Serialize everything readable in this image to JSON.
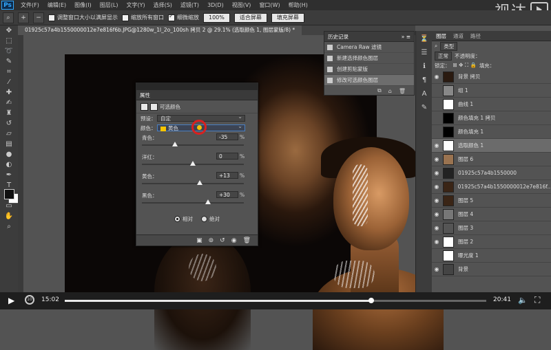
{
  "menubar": {
    "logo": "Ps",
    "items": [
      "文件(F)",
      "编辑(E)",
      "图像(I)",
      "图层(L)",
      "文字(Y)",
      "选择(S)",
      "滤镜(T)",
      "3D(D)",
      "视图(V)",
      "窗口(W)",
      "帮助(H)"
    ]
  },
  "watermark": {
    "text": "视达"
  },
  "optionsbar": {
    "resize_windows_label": "调整窗口大小以满屏显示",
    "zoom_all_label": "缩放所有窗口",
    "scrubby_zoom_label": "细微缩放",
    "zoom_value": "100%",
    "fit_screen_label": "适合屏幕",
    "fill_screen_label": "填充屏幕"
  },
  "document": {
    "tab_title": "01925c57a4b1550000012e7e816f6b.JPG@1280w_1l_2o_100sh 拷贝 2 @ 29.1% (选取颜色 1, 图层蒙版/8) *"
  },
  "history": {
    "title": "历史记录",
    "items": [
      "Camera Raw 滤镜",
      "新建选择颜色图层",
      "创建剪贴蒙版",
      "修改可选颜色图层"
    ],
    "selected": 3
  },
  "properties": {
    "title": "属性",
    "subtitle": "可选颜色",
    "preset_label": "预设：",
    "preset_value": "自定",
    "colors_label": "颜色：",
    "colors_value": "黄色",
    "sliders": [
      {
        "label": "青色：",
        "value": "-35",
        "pct": 0.325
      },
      {
        "label": "洋红：",
        "value": "0",
        "pct": 0.5
      },
      {
        "label": "黄色：",
        "value": "+13",
        "pct": 0.565
      },
      {
        "label": "黑色：",
        "value": "+30",
        "pct": 0.65
      }
    ],
    "percent_unit": "%",
    "method_relative": "相对",
    "method_absolute": "绝对"
  },
  "layers": {
    "tabs": [
      "图层",
      "通道",
      "路径"
    ],
    "filter_label": "类型",
    "blend_mode": "正常",
    "opacity_label": "不透明度：",
    "lock_label": "锁定：",
    "fill_label": "填充：",
    "items": [
      {
        "name": "背景 拷贝",
        "thumb": "#2a1a10",
        "visible": true
      },
      {
        "name": "组 1",
        "thumb": "#888888",
        "visible": false
      },
      {
        "name": "曲线 1",
        "thumb": "#ffffff",
        "visible": false
      },
      {
        "name": "颜色填充 1 拷贝",
        "thumb": "#000000",
        "visible": false
      },
      {
        "name": "颜色填充 1",
        "thumb": "#000000",
        "visible": false
      },
      {
        "name": "选取颜色 1",
        "thumb": "#ffffff",
        "visible": true
      },
      {
        "name": "图层 6",
        "thumb": "#9a7350",
        "visible": true
      },
      {
        "name": "01925c57a4b1550000",
        "thumb": "#222222",
        "visible": true
      },
      {
        "name": "01925c57a4b1550000012e7e816f...",
        "thumb": "#3a2516",
        "visible": true
      },
      {
        "name": "图层 5",
        "thumb": "#3a2516",
        "visible": true
      },
      {
        "name": "图层 4",
        "thumb": "#777777",
        "visible": true
      },
      {
        "name": "图层 3",
        "thumb": "#555555",
        "visible": true
      },
      {
        "name": "图层 2",
        "thumb": "#ffffff",
        "visible": true
      },
      {
        "name": "曝光度 1",
        "thumb": "#ffffff",
        "visible": false
      },
      {
        "name": "背景",
        "thumb": "#444444",
        "visible": true
      }
    ],
    "selected": 5
  },
  "player": {
    "current_time": "15:02",
    "total_time": "20:41",
    "progress": 0.727
  }
}
